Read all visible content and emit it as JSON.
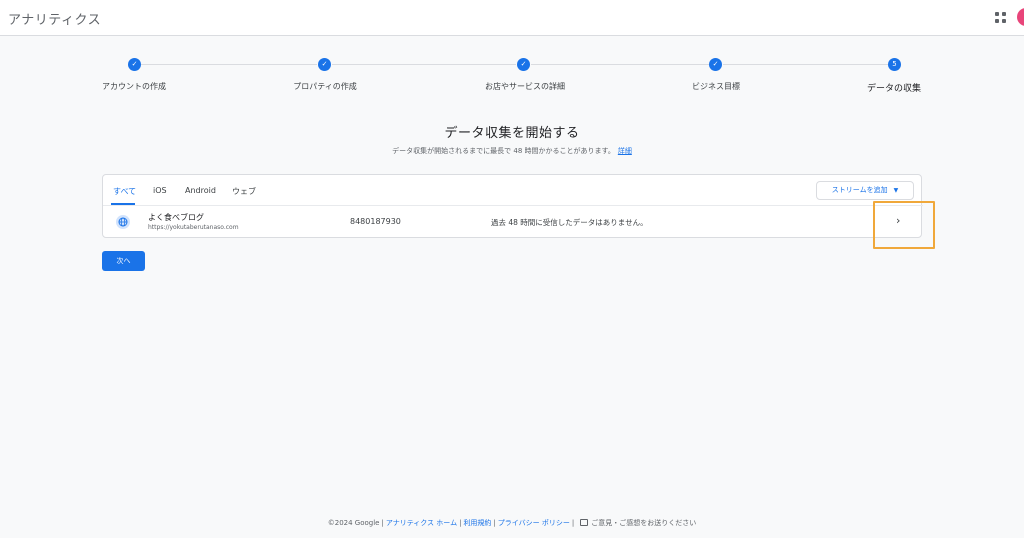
{
  "app": {
    "title": "アナリティクス"
  },
  "stepper": {
    "steps": [
      {
        "label": "アカウントの作成",
        "state": "done"
      },
      {
        "label": "プロパティの作成",
        "state": "done"
      },
      {
        "label": "お店やサービスの詳細",
        "state": "done"
      },
      {
        "label": "ビジネス目標",
        "state": "done"
      },
      {
        "label": "データの収集",
        "state": "current",
        "number": "5"
      }
    ]
  },
  "main": {
    "heading": "データ収集を開始する",
    "subheading": "データ収集が開始されるまでに最長で 48 時間かかることがあります。",
    "details_link": "詳細"
  },
  "tabs": [
    {
      "label": "すべて",
      "active": true
    },
    {
      "label": "iOS",
      "active": false
    },
    {
      "label": "Android",
      "active": false
    },
    {
      "label": "ウェブ",
      "active": false
    }
  ],
  "add_stream_label": "ストリームを追加",
  "stream": {
    "name": "よく食べブログ",
    "url": "https://yokutaberutanaso.com",
    "id": "8480187930",
    "status": "過去 48 時間に受信したデータはありません。"
  },
  "next_button": "次へ",
  "footer": {
    "copyright": "©2024 Google",
    "links": [
      "アナリティクス ホーム",
      "利用規約",
      "プライバシー ポリシー"
    ],
    "feedback": "ご意見・ご感想をお送りください"
  },
  "colors": {
    "accent": "#1a73e8",
    "highlight": "#f0a83a",
    "avatar": "#e8457a"
  }
}
